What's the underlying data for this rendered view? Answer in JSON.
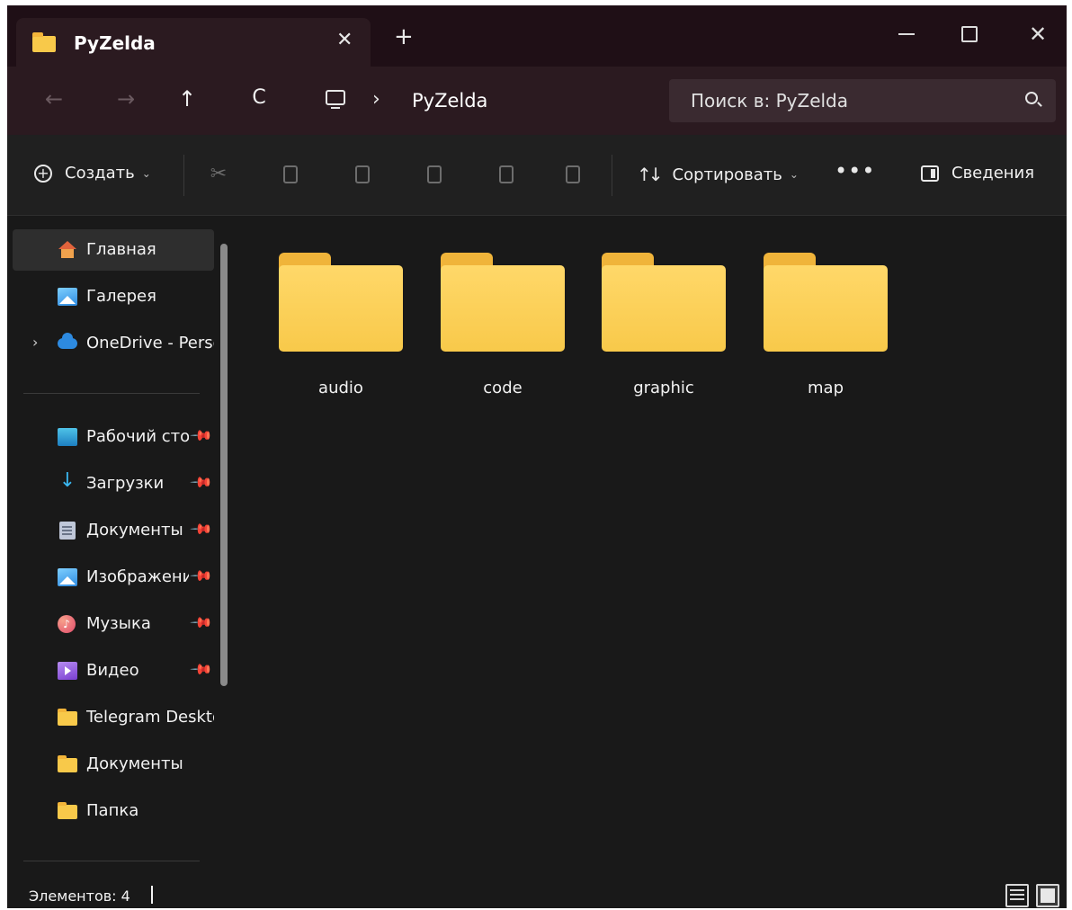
{
  "window": {
    "tab_title": "PyZelda",
    "icons": {
      "tab": "folder-icon",
      "close": "close-icon",
      "new_tab": "plus-icon"
    }
  },
  "nav": {
    "back": "←",
    "forward": "→",
    "up": "↑",
    "refresh": "C",
    "address_chevron": "›",
    "address_segment": "PyZelda",
    "search_placeholder": "Поиск в: PyZelda"
  },
  "toolbar": {
    "create_label": "Создать",
    "sort_label": "Сортировать",
    "more_label": "•••",
    "details_label": "Сведения",
    "caret": "⌄"
  },
  "sidebar": {
    "items": [
      {
        "label": "Главная",
        "icon": "home-icon",
        "selected": true
      },
      {
        "label": "Галерея",
        "icon": "gallery-icon"
      },
      {
        "label": "OneDrive - Personal",
        "icon": "onedrive-icon",
        "expandable": true
      },
      {
        "label": "Рабочий стол",
        "icon": "desktop-icon",
        "pinned": true
      },
      {
        "label": "Загрузки",
        "icon": "download-icon",
        "pinned": true
      },
      {
        "label": "Документы",
        "icon": "documents-icon",
        "pinned": true
      },
      {
        "label": "Изображения",
        "icon": "pictures-icon",
        "pinned": true
      },
      {
        "label": "Музыка",
        "icon": "music-icon",
        "pinned": true
      },
      {
        "label": "Видео",
        "icon": "video-icon",
        "pinned": true
      },
      {
        "label": "Telegram Desktop",
        "icon": "folder-icon"
      },
      {
        "label": "Документы",
        "icon": "folder-icon"
      },
      {
        "label": "Папка",
        "icon": "folder-icon"
      }
    ]
  },
  "content": {
    "folders": [
      {
        "name": "audio"
      },
      {
        "name": "code"
      },
      {
        "name": "graphic"
      },
      {
        "name": "map"
      }
    ]
  },
  "status": {
    "items_count": "Элементов: 4"
  },
  "colors": {
    "titlebar": "#1f0f16",
    "address_bar": "#2b1a20",
    "toolbar": "#202020",
    "background": "#191919",
    "folder": "#f8c94a"
  }
}
